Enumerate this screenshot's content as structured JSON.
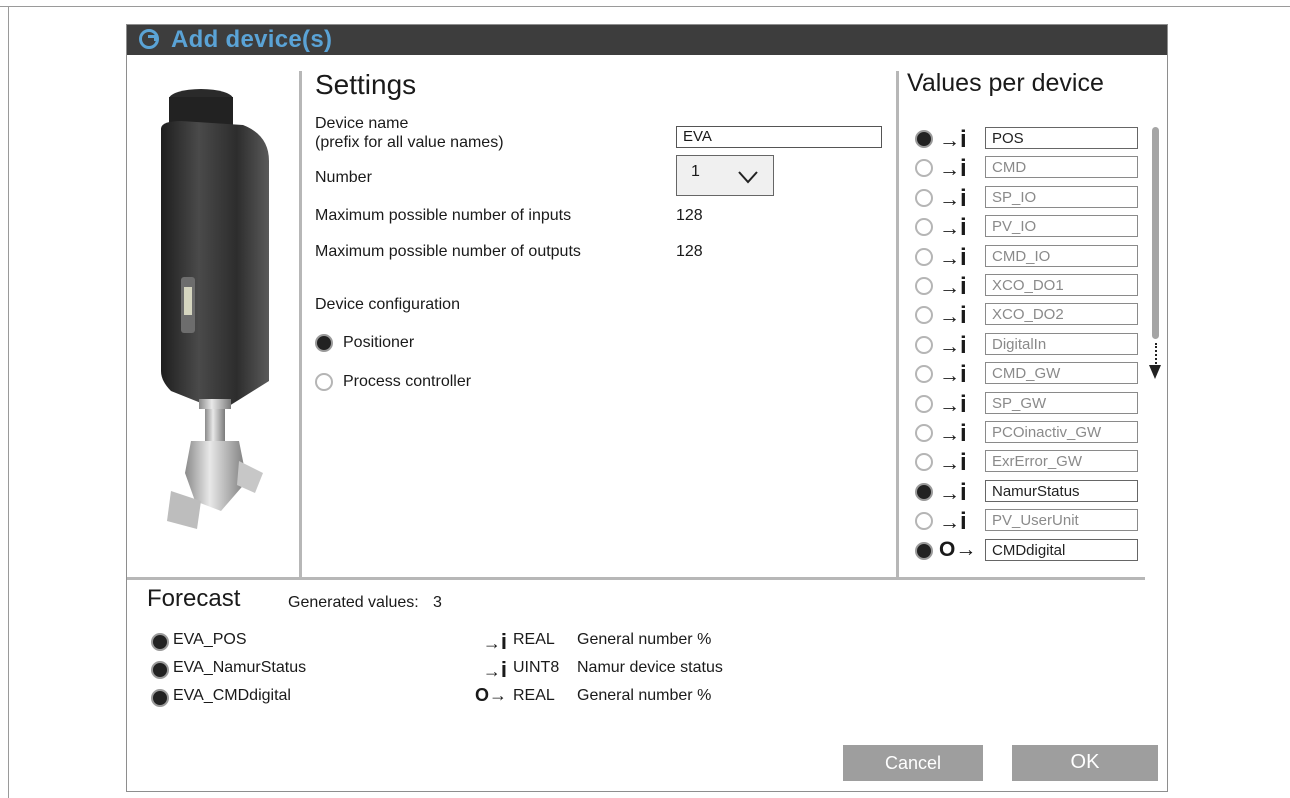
{
  "dialog": {
    "title": "Add device(s)"
  },
  "settings": {
    "heading": "Settings",
    "device_name_label_1": "Device name",
    "device_name_label_2": "(prefix for all value names)",
    "device_name_value": "EVA",
    "number_label": "Number",
    "number_value": "1",
    "max_inputs_label": "Maximum possible number of inputs",
    "max_inputs_value": "128",
    "max_outputs_label": "Maximum possible number of outputs",
    "max_outputs_value": "128",
    "config_label": "Device configuration",
    "options": [
      {
        "label": "Positioner",
        "selected": true
      },
      {
        "label": "Process controller",
        "selected": false
      }
    ]
  },
  "values_per_device": {
    "heading": "Values per device",
    "items": [
      {
        "name": "POS",
        "dir": "input",
        "selected": true
      },
      {
        "name": "CMD",
        "dir": "input",
        "selected": false
      },
      {
        "name": "SP_IO",
        "dir": "input",
        "selected": false
      },
      {
        "name": "PV_IO",
        "dir": "input",
        "selected": false
      },
      {
        "name": "CMD_IO",
        "dir": "input",
        "selected": false
      },
      {
        "name": "XCO_DO1",
        "dir": "input",
        "selected": false
      },
      {
        "name": "XCO_DO2",
        "dir": "input",
        "selected": false
      },
      {
        "name": "DigitalIn",
        "dir": "input",
        "selected": false
      },
      {
        "name": "CMD_GW",
        "dir": "input",
        "selected": false
      },
      {
        "name": "SP_GW",
        "dir": "input",
        "selected": false
      },
      {
        "name": "PCOinactiv_GW",
        "dir": "input",
        "selected": false
      },
      {
        "name": "ExrError_GW",
        "dir": "input",
        "selected": false
      },
      {
        "name": "NamurStatus",
        "dir": "input",
        "selected": true
      },
      {
        "name": "PV_UserUnit",
        "dir": "input",
        "selected": false
      },
      {
        "name": "CMDdigital",
        "dir": "output",
        "selected": true
      }
    ]
  },
  "forecast": {
    "heading": "Forecast",
    "generated_label": "Generated values:",
    "generated_count": "3",
    "rows": [
      {
        "name": "EVA_POS",
        "dir": "input",
        "type": "REAL",
        "desc": "General number %"
      },
      {
        "name": "EVA_NamurStatus",
        "dir": "input",
        "type": "UINT8",
        "desc": "Namur device status"
      },
      {
        "name": "EVA_CMDdigital",
        "dir": "output",
        "type": "REAL",
        "desc": "General number %"
      }
    ]
  },
  "buttons": {
    "cancel": "Cancel",
    "ok": "OK"
  },
  "colors": {
    "title_bar": "#3d3d3d",
    "accent": "#5aa3d6",
    "button": "#9e9e9e",
    "divider": "#b7b7b7"
  }
}
